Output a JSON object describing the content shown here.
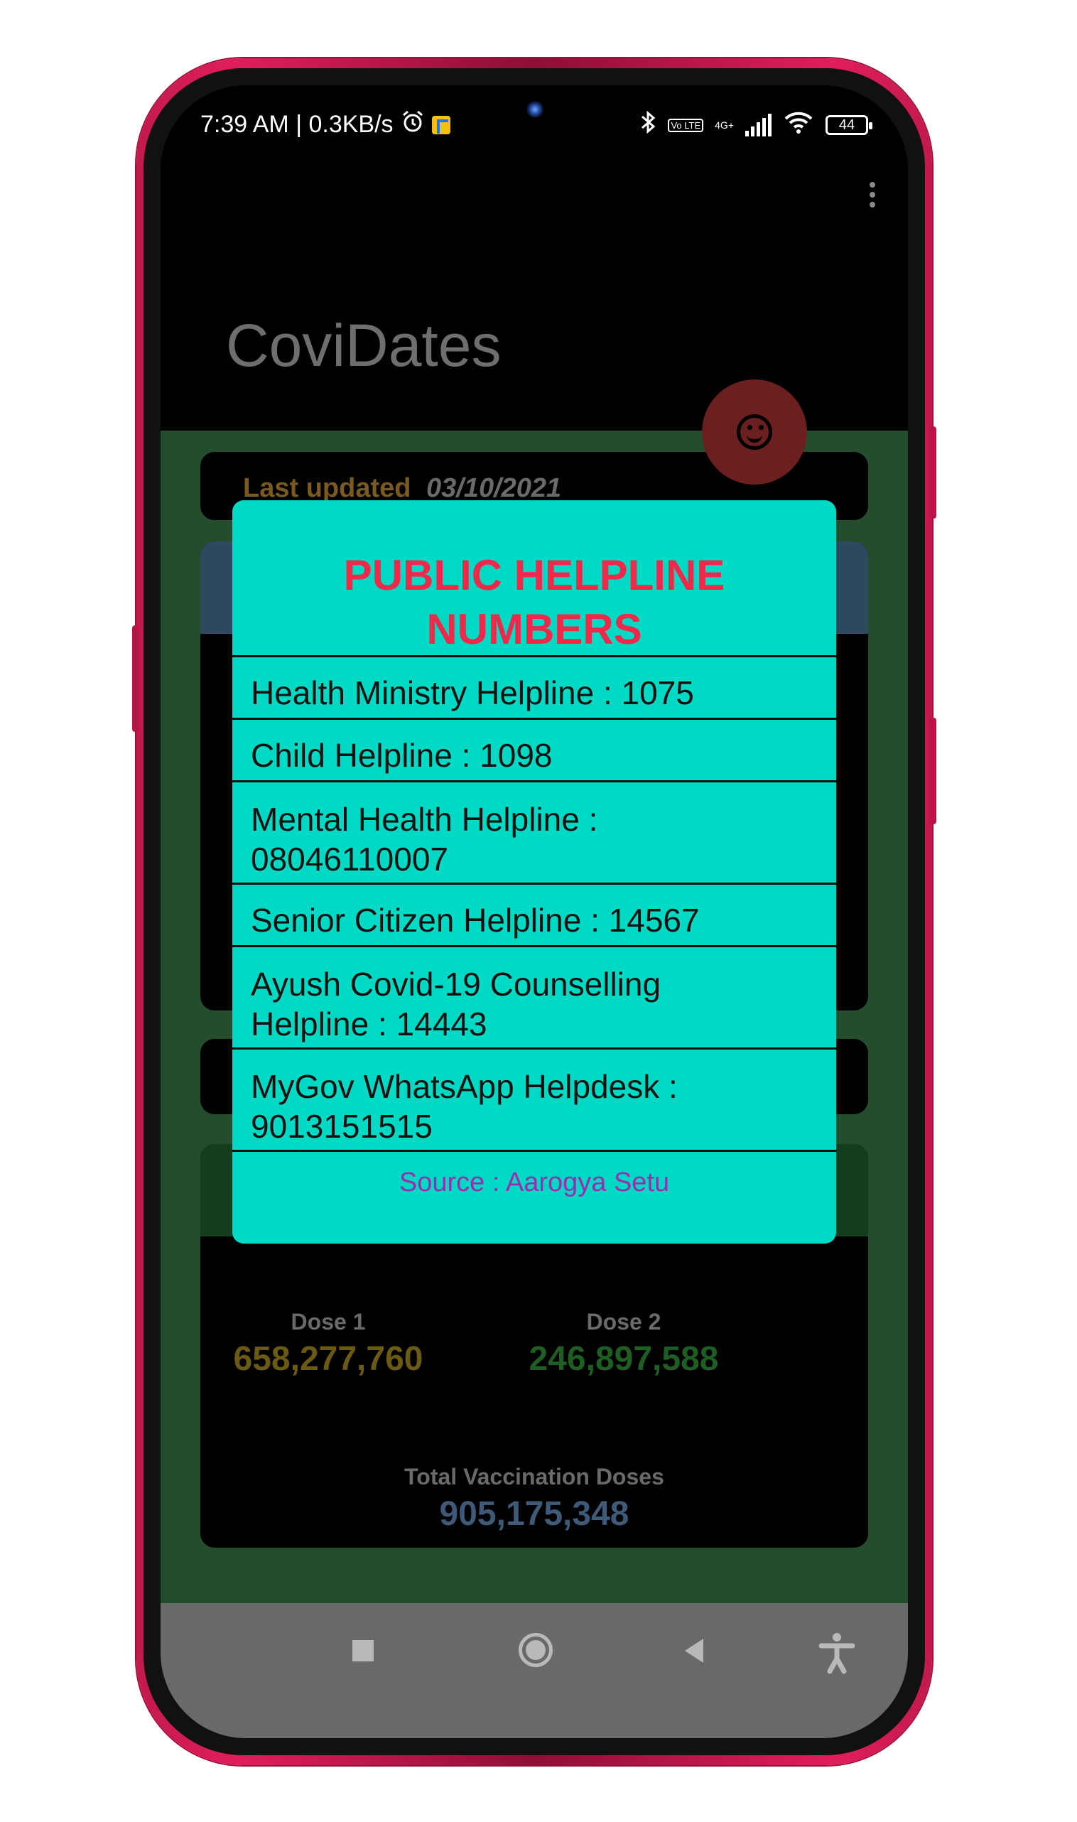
{
  "status_bar": {
    "time_speed": "7:39 AM | 0.3KB/s",
    "network": "4G+",
    "volte": "Vo LTE",
    "battery": "44"
  },
  "app": {
    "title": "CoviDates"
  },
  "last_updated": {
    "label": "Last updated",
    "date": "03/10/2021"
  },
  "vaccination": {
    "dose1_label": "Dose 1",
    "dose1_value": "658,277,760",
    "dose2_label": "Dose 2",
    "dose2_value": "246,897,588",
    "total_label": "Total Vaccination Doses",
    "total_value": "905,175,348"
  },
  "dialog": {
    "title_line1": "PUBLIC HELPLINE",
    "title_line2": "NUMBERS",
    "rows": [
      {
        "line1": "Health Ministry Helpline : 1075"
      },
      {
        "line1": "Child Helpline : 1098"
      },
      {
        "line1": "Mental Health Helpline :",
        "line2": "08046110007"
      },
      {
        "line1": "Senior Citizen Helpline : 14567"
      },
      {
        "line1": "Ayush Covid-19 Counselling",
        "line2": "Helpline : 14443"
      },
      {
        "line1": "MyGov WhatsApp Helpdesk :",
        "line2": "9013151515"
      }
    ],
    "source": "Source : Aarogya Setu"
  },
  "colors": {
    "dialog_bg": "#00d9c4",
    "dialog_title": "#f0284a",
    "source_text": "#9b2db0",
    "content_bg": "#244d2d",
    "fab": "#6b1f1f",
    "dose1": "#6b5a14",
    "dose2": "#1f5e23",
    "total": "#3f5a78"
  },
  "icons": [
    "smiley-icon",
    "overflow-menu-icon",
    "bluetooth-icon",
    "wifi-icon",
    "alarm-icon",
    "battery-icon",
    "accessibility-icon"
  ]
}
